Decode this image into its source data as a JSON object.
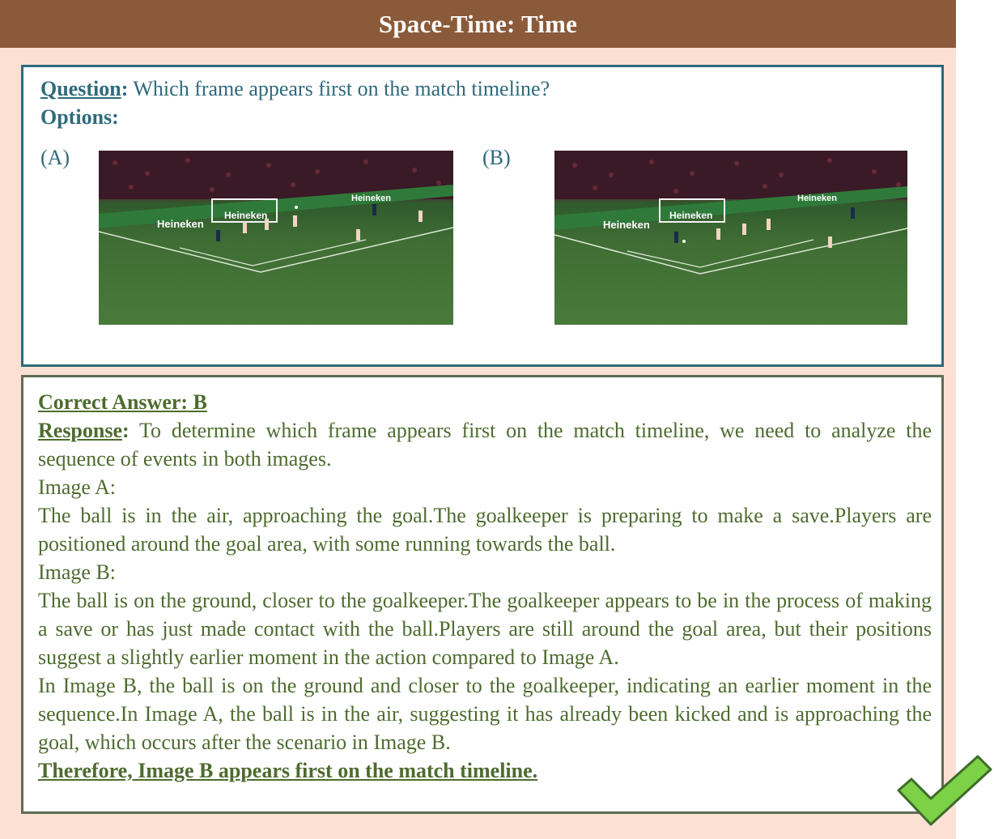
{
  "header": {
    "title": "Space-Time: Time"
  },
  "question": {
    "label": "Question",
    "text": " Which frame appears first on the match timeline?",
    "options_label": "Options:",
    "options": [
      {
        "label": "(A)"
      },
      {
        "label": "(B)"
      }
    ]
  },
  "answer": {
    "correct_answer": "Correct Answer: B",
    "response_label": "Response",
    "response_intro": " To determine which frame appears first on the match timeline, we need to analyze the sequence of events in both images.",
    "image_a_label": "Image A:",
    "image_a_text": "The ball is in the air, approaching the goal.The goalkeeper is preparing to make a save.Players are positioned around the goal area, with some running towards the ball.",
    "image_b_label": "Image B:",
    "image_b_text": "The ball is on the ground, closer to the goalkeeper.The goalkeeper appears to be in the process of making a save or has just made contact with the ball.Players are still around the goal area, but their positions suggest a slightly earlier moment in the action compared to Image A.",
    "comparison": "In Image B, the ball is on the ground and closer to the goalkeeper, indicating an earlier moment in the sequence.In Image A, the ball is in the air, suggesting it has already been kicked and is approaching the goal, which occurs after the scenario in Image B.",
    "conclusion": "Therefore, Image B appears first on the match timeline."
  },
  "frames": {
    "a": {
      "ad_board_text": "Heineken"
    },
    "b": {
      "ad_board_text": "Heineken"
    }
  },
  "icons": {
    "check": "checkmark-icon"
  },
  "colors": {
    "header_bg": "#8b5a3a",
    "panel_bg": "#fbe0d3",
    "question_border": "#2f6a7c",
    "answer_border": "#5e6d57",
    "answer_text": "#4e6b2f",
    "check_fill": "#7cd147"
  }
}
